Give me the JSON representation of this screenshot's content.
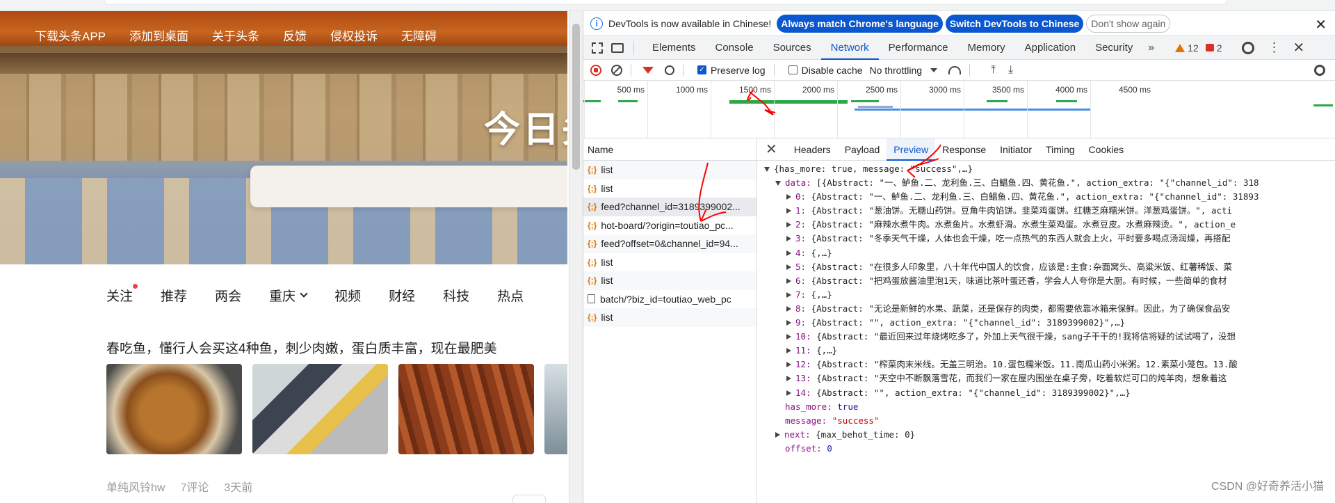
{
  "page": {
    "top_nav": [
      "下载头条APP",
      "添加到桌面",
      "关于头条",
      "反馈",
      "侵权投诉",
      "无障碍"
    ],
    "hero_title": "今日头",
    "channels": [
      "关注",
      "推荐",
      "两会",
      "重庆",
      "视频",
      "财经",
      "科技",
      "热点"
    ],
    "article_title": "春吃鱼，懂行人会买这4种鱼，刺少肉嫩，蛋白质丰富，现在最肥美",
    "meta": {
      "author": "单纯风铃hw",
      "comments": "7评论",
      "time": "3天前"
    }
  },
  "devtools": {
    "infobar": {
      "message": "DevTools is now available in Chinese!",
      "btn_match": "Always match Chrome's language",
      "btn_switch": "Switch DevTools to Chinese",
      "btn_dismiss": "Don't show again"
    },
    "tabs": [
      "Elements",
      "Console",
      "Sources",
      "Network",
      "Performance",
      "Memory",
      "Application",
      "Security"
    ],
    "active_tab": "Network",
    "warnings": "12",
    "errors": "2",
    "toolbar": {
      "preserve_log": "Preserve log",
      "disable_cache": "Disable cache",
      "throttling": "No throttling"
    },
    "timeline_ticks": [
      "500 ms",
      "1000 ms",
      "1500 ms",
      "2000 ms",
      "2500 ms",
      "3000 ms",
      "3500 ms",
      "4000 ms",
      "4500 ms"
    ],
    "name_header": "Name",
    "requests": [
      {
        "name": "list",
        "type": "xhr"
      },
      {
        "name": "list",
        "type": "xhr"
      },
      {
        "name": "feed?channel_id=3189399002...",
        "type": "xhr"
      },
      {
        "name": "hot-board/?origin=toutiao_pc...",
        "type": "xhr"
      },
      {
        "name": "feed?offset=0&channel_id=94...",
        "type": "xhr"
      },
      {
        "name": "list",
        "type": "xhr"
      },
      {
        "name": "list",
        "type": "xhr"
      },
      {
        "name": "batch/?biz_id=toutiao_web_pc",
        "type": "doc"
      },
      {
        "name": "list",
        "type": "xhr"
      }
    ],
    "detail_tabs": [
      "Headers",
      "Payload",
      "Preview",
      "Response",
      "Initiator",
      "Timing",
      "Cookies"
    ],
    "active_detail_tab": "Preview",
    "preview": {
      "root": "{has_more: true, message: \"success\",…}",
      "data_line": "[{Abstract: \"一、鲈鱼.二、龙利鱼.三、白鲳鱼.四、黄花鱼.\", action_extra: \"{\"channel_id\": 318",
      "items": [
        {
          "i": "0",
          "text": "{Abstract: \"一、鲈鱼.二、龙利鱼.三、白鲳鱼.四、黄花鱼.\", action_extra: \"{\"channel_id\": 31893"
        },
        {
          "i": "1",
          "text": "{Abstract: \"葱油饼。无糖山药饼。豆角牛肉馅饼。韭菜鸡蛋饼。红糖芝麻糯米饼。洋葱鸡蛋饼。\", acti"
        },
        {
          "i": "2",
          "text": "{Abstract: \"麻辣水煮牛肉。水煮鱼片。水煮虾滑。水煮生菜鸡蛋。水煮豆皮。水煮麻辣烫。\", action_e"
        },
        {
          "i": "3",
          "text": "{Abstract: \"冬季天气干燥，人体也会干燥，吃一点热气的东西人就会上火，平时要多喝点汤润燥，再搭配"
        },
        {
          "i": "4",
          "text": "{,…}"
        },
        {
          "i": "5",
          "text": "{Abstract: \"在很多人印象里，八十年代中国人的饮食，应该是:主食:杂面窝头、高粱米饭、红薯稀饭、菜"
        },
        {
          "i": "6",
          "text": "{Abstract: \"把鸡蛋放酱油里泡1天，味道比茶叶蛋还香，学会人人夸你是大厨。有时候，一些简单的食材"
        },
        {
          "i": "7",
          "text": "{,…}"
        },
        {
          "i": "8",
          "text": "{Abstract: \"无论是新鲜的水果、蔬菜，还是保存的肉类，都需要依靠冰箱来保鲜。因此，为了确保食品安"
        },
        {
          "i": "9",
          "text": "{Abstract: \"\", action_extra: \"{\"channel_id\": 3189399002}\",…}"
        },
        {
          "i": "10",
          "text": "{Abstract: \"最近回来过年烧烤吃多了，外加上天气很干燥，sang子干干的!我将信将疑的试试喝了，没想"
        },
        {
          "i": "11",
          "text": "{,…}"
        },
        {
          "i": "12",
          "text": "{Abstract: \"榨菜肉末米线。无盖三明治。10.蛋包糯米饭。11.南瓜山药小米粥。12.素菜小笼包。13.酸"
        },
        {
          "i": "13",
          "text": "{Abstract: \"天空中不断飘落雪花，而我们一家在屋内围坐在桌子旁，吃着软烂可口的炖羊肉，想象着这"
        },
        {
          "i": "14",
          "text": "{Abstract: \"\", action_extra: \"{\"channel_id\": 3189399002}\",…}"
        }
      ],
      "has_more_key": "has_more:",
      "has_more_val": "true",
      "message_key": "message:",
      "message_val": "\"success\"",
      "next_key": "next:",
      "next_val": "{max_behot_time: 0}",
      "offset_key": "offset:",
      "offset_val": "0"
    },
    "watermark": "CSDN @好奇养活小猫"
  },
  "colors": {
    "accent": "#0b57d0",
    "error": "#d93025",
    "warning": "#e37400",
    "annotation": "#ff0000"
  }
}
